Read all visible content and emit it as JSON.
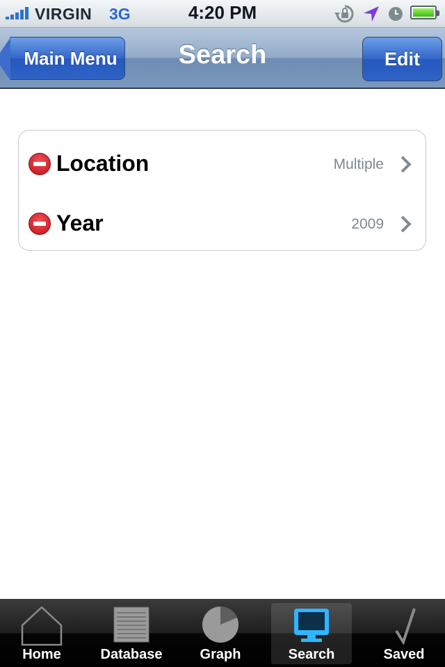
{
  "status_bar": {
    "carrier": "VIRGIN",
    "network": "3G",
    "time": "4:20 PM",
    "icons": [
      "signal-icon",
      "rotation-lock-icon",
      "location-arrow-icon",
      "alarm-clock-icon",
      "battery-icon"
    ],
    "battery_level": 1.0
  },
  "nav": {
    "back_label": "Main Menu",
    "title": "Search",
    "edit_label": "Edit"
  },
  "filters": [
    {
      "label": "Location",
      "value": "Multiple"
    },
    {
      "label": "Year",
      "value": "2009"
    }
  ],
  "tabs": [
    {
      "label": "Home",
      "icon": "house-icon"
    },
    {
      "label": "Database",
      "icon": "database-icon"
    },
    {
      "label": "Graph",
      "icon": "pie-chart-icon"
    },
    {
      "label": "Search",
      "icon": "computer-icon",
      "selected": true
    },
    {
      "label": "Saved",
      "icon": "checkmark-icon"
    }
  ],
  "colors": {
    "nav_button": "#3466c8",
    "delete": "#c1101b",
    "search_tab_icon": "#2fb6ff"
  }
}
